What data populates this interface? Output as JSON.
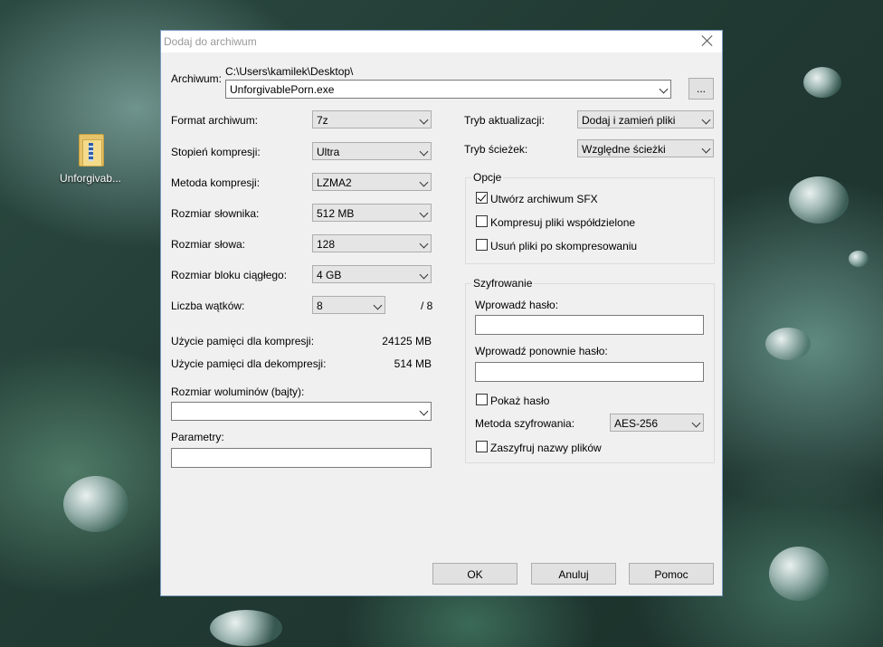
{
  "desktop": {
    "icon_label": "Unforgivab..."
  },
  "dialog": {
    "title": "Dodaj do archiwum",
    "archive_label": "Archiwum:",
    "archive_path": "C:\\Users\\kamilek\\Desktop\\",
    "archive_name": "UnforgivablePorn.exe",
    "browse_label": "...",
    "left": {
      "format": {
        "label": "Format archiwum:",
        "value": "7z"
      },
      "level": {
        "label": "Stopień kompresji:",
        "value": "Ultra"
      },
      "method": {
        "label": "Metoda kompresji:",
        "value": "LZMA2"
      },
      "dict": {
        "label": "Rozmiar słownika:",
        "value": "512 MB"
      },
      "word": {
        "label": "Rozmiar słowa:",
        "value": "128"
      },
      "block": {
        "label": "Rozmiar bloku ciągłego:",
        "value": "4 GB"
      },
      "threads": {
        "label": "Liczba wątków:",
        "value": "8",
        "max": "/ 8"
      },
      "mem_comp": {
        "label": "Użycie pamięci dla kompresji:",
        "value": "24125 MB"
      },
      "mem_decomp": {
        "label": "Użycie pamięci dla dekompresji:",
        "value": "514 MB"
      },
      "volumes_label": "Rozmiar woluminów (bajty):",
      "volumes_value": "",
      "params_label": "Parametry:",
      "params_value": ""
    },
    "right": {
      "update": {
        "label": "Tryb aktualizacji:",
        "value": "Dodaj i zamień pliki"
      },
      "paths": {
        "label": "Tryb ścieżek:",
        "value": "Względne ścieżki"
      },
      "options": {
        "title": "Opcje",
        "sfx": {
          "label": "Utwórz archiwum SFX",
          "checked": true
        },
        "shared": {
          "label": "Kompresuj pliki współdzielone",
          "checked": false
        },
        "delete": {
          "label": "Usuń pliki po skompresowaniu",
          "checked": false
        }
      },
      "encryption": {
        "title": "Szyfrowanie",
        "password_label": "Wprowadź hasło:",
        "password_value": "",
        "repeat_label": "Wprowadź ponownie hasło:",
        "repeat_value": "",
        "show_label": "Pokaż hasło",
        "method_label": "Metoda szyfrowania:",
        "method_value": "AES-256",
        "names_label": "Zaszyfruj nazwy plików"
      }
    },
    "buttons": {
      "ok": "OK",
      "cancel": "Anuluj",
      "help": "Pomoc"
    }
  }
}
